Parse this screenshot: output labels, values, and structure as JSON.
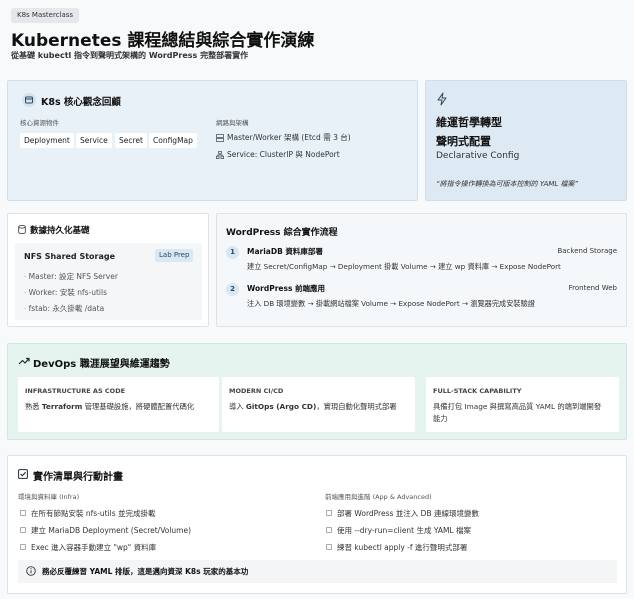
{
  "header": {
    "tag": "K8s Masterclass",
    "title": "Kubernetes 課程總結與綜合實作演練",
    "subtitle": "從基礎 kubectl 指令到聲明式架構的 WordPress 完整部署實作"
  },
  "concepts": {
    "title": "K8s 核心觀念回顧",
    "resources_label": "核心資源物件",
    "resources": [
      "Deployment",
      "Service",
      "Secret",
      "ConfigMap"
    ],
    "network_label": "網路與架構",
    "network_items": [
      "Master/Worker 架構 (Etcd 需 3 台)",
      "Service: ClusterIP 與 NodePort"
    ]
  },
  "philosophy": {
    "line1": "維運哲學轉型",
    "line2": "聲明式配置",
    "line3": "Declarative Config",
    "quote": "“將指令操作轉換為可版本控制的 YAML 檔案”"
  },
  "persistence": {
    "title": "數據持久化基礎",
    "item_title": "NFS Shared Storage",
    "badge": "Lab Prep",
    "items": [
      "Master: 設定 NFS Server",
      "Worker: 安裝 nfs-utils",
      "fstab: 永久掛載 /data"
    ]
  },
  "workflow": {
    "title": "WordPress 綜合實作流程",
    "steps": [
      {
        "num": "1",
        "title": "MariaDB 資料庫部署",
        "tag": "Backend Storage",
        "desc": "建立 Secret/ConfigMap → Deployment 掛載 Volume → 建立 wp 資料庫 → Expose NodePort"
      },
      {
        "num": "2",
        "title": "WordPress 前端應用",
        "tag": "Frontend Web",
        "desc": "注入 DB 環境變數 → 掛載網站檔案 Volume → Expose NodePort → 瀏覽器完成安裝驗證"
      }
    ]
  },
  "devops": {
    "title": "DevOps 職涯展望與維運趨勢",
    "cards": [
      {
        "label": "INFRASTRUCTURE AS CODE",
        "pre": "熟悉 ",
        "bold": "Terraform",
        "post": " 管理基礎設施，將硬體配置代碼化"
      },
      {
        "label": "MODERN CI/CD",
        "pre": "導入 ",
        "bold": "GitOps (Argo CD)",
        "post": "，實現自動化聲明式部署"
      },
      {
        "label": "FULL-STACK CAPABILITY",
        "line1": "具備打包 Image 與撰寫高品質 YAML 的端到端開發",
        "line2": "能力"
      }
    ]
  },
  "actions": {
    "title": "實作清單與行動計畫",
    "infra_label": "環境與資料庫 (Infra)",
    "infra_items": [
      "在所有節點安裝 nfs-utils 並完成掛載",
      "建立 MariaDB Deployment (Secret/Volume)",
      "Exec 進入容器手動建立 \"wp\" 資料庫"
    ],
    "app_label": "前端應用與進階 (App & Advanced)",
    "app_items": [
      "部署 WordPress 並注入 DB 連線環境變數",
      "使用 --dry-run=client 生成 YAML 檔案",
      "練習 kubectl apply -f 進行聲明式部署"
    ],
    "note": "務必反覆練習 YAML 排版，這是邁向資深 K8s 玩家的基本功"
  },
  "colors": {
    "accent": "#2b4a63",
    "blue_card": "#e8f1f8",
    "green_card": "#e5f4ee"
  }
}
